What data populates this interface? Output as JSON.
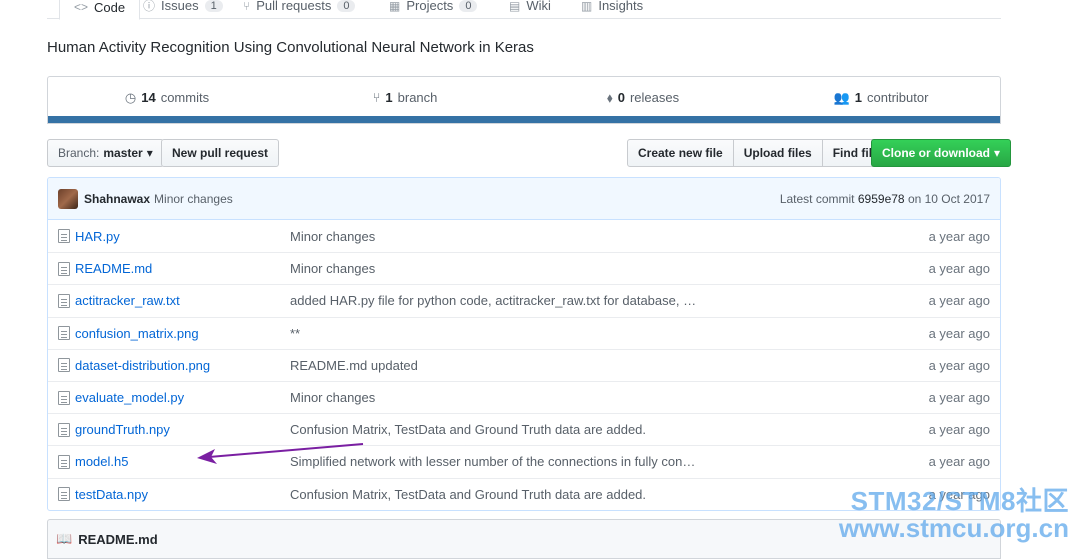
{
  "tabs": [
    {
      "label": "Code",
      "counter": "",
      "selected": true,
      "icon": "code-icon"
    },
    {
      "label": "Issues",
      "counter": "1",
      "selected": false,
      "icon": "issue-icon"
    },
    {
      "label": "Pull requests",
      "counter": "0",
      "selected": false,
      "icon": "pull-request-icon"
    },
    {
      "label": "Projects",
      "counter": "0",
      "selected": false,
      "icon": "project-icon"
    },
    {
      "label": "Wiki",
      "counter": "",
      "selected": false,
      "icon": "book-icon"
    },
    {
      "label": "Insights",
      "counter": "",
      "selected": false,
      "icon": "graph-icon"
    }
  ],
  "repo": {
    "description": "Human Activity Recognition Using Convolutional Neural Network in Keras"
  },
  "summary": {
    "commits_num": "14",
    "commits_label": "commits",
    "branch_num": "1",
    "branch_label": "branch",
    "releases_num": "0",
    "releases_label": "releases",
    "contributor_num": "1",
    "contributor_label": "contributor"
  },
  "toolbar": {
    "branch_prefix": "Branch:",
    "branch_name": "master",
    "new_pr": "New pull request",
    "create_file": "Create new file",
    "upload_files": "Upload files",
    "find_file": "Find file",
    "clone": "Clone or download"
  },
  "commit": {
    "author": "Shahnawax",
    "message": "Minor changes",
    "latest_prefix": "Latest commit",
    "sha": "6959e78",
    "date": "on 10 Oct 2017"
  },
  "files": [
    {
      "name": "HAR.py",
      "message": "Minor changes",
      "age": "a year ago"
    },
    {
      "name": "README.md",
      "message": "Minor changes",
      "age": "a year ago"
    },
    {
      "name": "actitracker_raw.txt",
      "message": "added HAR.py file for python code, actitracker_raw.txt for database, …",
      "age": "a year ago"
    },
    {
      "name": "confusion_matrix.png",
      "message": "**",
      "age": "a year ago"
    },
    {
      "name": "dataset-distribution.png",
      "message": "README.md updated",
      "age": "a year ago"
    },
    {
      "name": "evaluate_model.py",
      "message": "Minor changes",
      "age": "a year ago"
    },
    {
      "name": "groundTruth.npy",
      "message": "Confusion Matrix, TestData and Ground Truth data are added.",
      "age": "a year ago"
    },
    {
      "name": "model.h5",
      "message": "Simplified network with lesser number of the connections in fully con…",
      "age": "a year ago"
    },
    {
      "name": "testData.npy",
      "message": "Confusion Matrix, TestData and Ground Truth data are added.",
      "age": "a year ago"
    }
  ],
  "readme": {
    "title": "README.md"
  },
  "watermark": {
    "line1": "STM32/STM8社区",
    "line2": "www.stmcu.org.cn"
  },
  "colors": {
    "accent": "#0366d6",
    "green": "#28a745",
    "lang_bar": "#3572a5",
    "arrow": "#7a1fa2"
  }
}
